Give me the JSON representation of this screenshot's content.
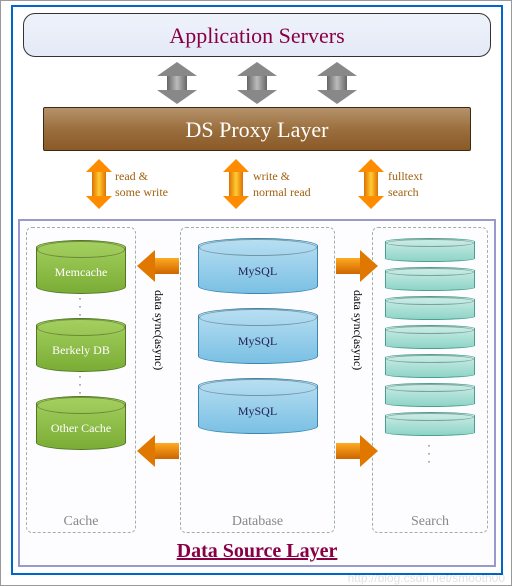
{
  "header": {
    "title": "Application  Servers"
  },
  "proxy": {
    "label": "DS Proxy Layer"
  },
  "flows": {
    "cache": {
      "line1": "read &",
      "line2": "some write"
    },
    "db": {
      "line1": "write &",
      "line2": "normal read"
    },
    "search": {
      "line1": "fulltext",
      "line2": "search"
    }
  },
  "sync": {
    "label": "data sync(async)"
  },
  "columns": {
    "cache": {
      "title": "Cache",
      "items": [
        "Memcache",
        "Berkely DB",
        "Other Cache"
      ]
    },
    "db": {
      "title": "Database",
      "items": [
        "MySQL",
        "MySQL",
        "MySQL"
      ]
    },
    "search": {
      "title": "Search"
    }
  },
  "layer": {
    "title": "Data Source Layer"
  },
  "watermark": "http://blog.csdn.net/smooth00"
}
